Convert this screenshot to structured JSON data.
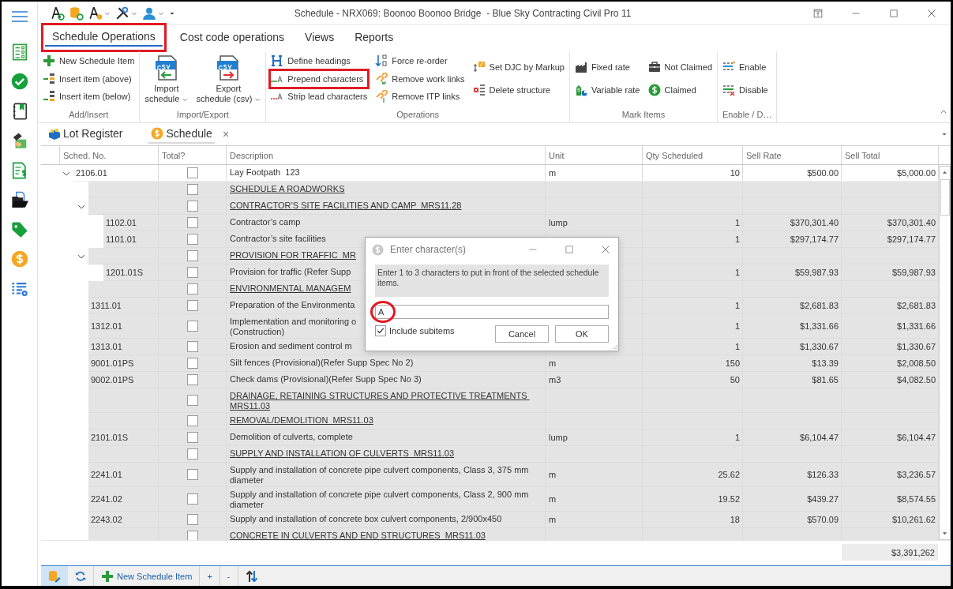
{
  "title_bar": {
    "title": "Schedule - NRX069: Boonoo Boonoo Bridge  - Blue Sky Contracting Civil Pro 11"
  },
  "ribbon": {
    "tabs": [
      {
        "label": "Schedule Operations",
        "selected": true,
        "highlighted": true
      },
      {
        "label": "Cost code operations",
        "selected": false,
        "highlighted": false
      },
      {
        "label": "Views",
        "selected": false,
        "highlighted": false
      },
      {
        "label": "Reports",
        "selected": false,
        "highlighted": false
      }
    ],
    "groups": [
      {
        "kind": "columns",
        "label": "Add/Insert",
        "columns": [
          [
            {
              "label": "New Schedule Item",
              "highlighted": false
            },
            {
              "label": "Insert item (above)",
              "highlighted": false
            },
            {
              "label": "Insert item (below)",
              "highlighted": false
            }
          ]
        ]
      },
      {
        "kind": "large",
        "label": "Import/Export",
        "buttons": [
          {
            "label": "Import\nschedule",
            "dropdown": true
          },
          {
            "label": "Export\nschedule (csv)",
            "dropdown": true
          }
        ]
      },
      {
        "kind": "columns",
        "label": "Operations",
        "columns": [
          [
            {
              "label": "Define headings",
              "highlighted": false
            },
            {
              "label": "Prepend characters",
              "highlighted": true
            },
            {
              "label": "Strip lead characters",
              "highlighted": false
            }
          ],
          [
            {
              "label": "Force re-order",
              "highlighted": false
            },
            {
              "label": "Remove work links",
              "highlighted": false
            },
            {
              "label": "Remove ITP links",
              "highlighted": false
            }
          ],
          [
            {
              "label": "Set DJC by Markup",
              "highlighted": false
            },
            {
              "label": "Delete structure",
              "highlighted": false
            }
          ]
        ]
      },
      {
        "kind": "columns",
        "label": "Mark Items",
        "columns": [
          [
            {
              "label": "Fixed rate",
              "highlighted": false
            },
            {
              "label": "Variable rate",
              "highlighted": false
            }
          ],
          [
            {
              "label": "Not Claimed",
              "highlighted": false
            },
            {
              "label": "Claimed",
              "highlighted": false
            }
          ]
        ]
      },
      {
        "kind": "columns",
        "label": "Enable / D…",
        "columns": [
          [
            {
              "label": "Enable",
              "highlighted": false
            },
            {
              "label": "Disable",
              "highlighted": false
            }
          ]
        ]
      }
    ]
  },
  "document_tabs": [
    {
      "label": "Lot Register",
      "selected": false
    },
    {
      "label": "Schedule",
      "selected": true,
      "close": "×"
    }
  ],
  "grid": {
    "columns": [
      "Sched. No.",
      "Total?",
      "Description",
      "Unit",
      "Qty Scheduled",
      "Sell Rate",
      "Sell Total"
    ],
    "rows": [
      {
        "sched_no": "2106.01",
        "total": false,
        "kind": "item",
        "description": "Lay Footpath  123",
        "unit": "m",
        "qty": "10",
        "sell_rate": "$500.00",
        "sell_total": "$5,000.00",
        "selected": false,
        "expanded": true,
        "children": [
          {
            "total": false,
            "kind": "heading",
            "description": "SCHEDULE A ROADWORKS",
            "selected": true
          },
          {
            "total": false,
            "kind": "heading",
            "description": "CONTRACTOR’S SITE FACILITIES AND CAMP  MRS11.28",
            "selected": true,
            "expanded": true,
            "children": [
              {
                "sched_no": "1102.01",
                "total": false,
                "kind": "item",
                "description": "Contractor’s camp",
                "unit": "lump",
                "qty": "1",
                "sell_rate": "$370,301.40",
                "sell_total": "$370,301.40",
                "selected": true
              },
              {
                "sched_no": "1101.01",
                "total": false,
                "kind": "item",
                "description": "Contractor’s site facilities",
                "qty": "1",
                "sell_rate": "$297,174.77",
                "sell_total": "$297,174.77",
                "selected": true
              }
            ]
          },
          {
            "total": false,
            "kind": "heading",
            "description": "PROVISION FOR TRAFFIC  MR",
            "selected": true,
            "expanded": true,
            "children": [
              {
                "sched_no": "1201.01S",
                "total": false,
                "kind": "item",
                "description": "Provision for traffic (Refer Supp",
                "qty": "1",
                "sell_rate": "$59,987.93",
                "sell_total": "$59,987.93",
                "selected": true
              }
            ]
          },
          {
            "total": false,
            "kind": "heading",
            "description": "ENVIRONMENTAL MANAGEM",
            "selected": true
          },
          {
            "sched_no": "1311.01",
            "total": false,
            "kind": "item",
            "description": "Preparation of the Environmenta",
            "qty": "1",
            "sell_rate": "$2,681.83",
            "sell_total": "$2,681.83",
            "selected": true
          },
          {
            "sched_no": "1312.01",
            "total": false,
            "kind": "item",
            "description": "Implementation and monitoring o\n(Construction)",
            "qty": "1",
            "sell_rate": "$1,331.66",
            "sell_total": "$1,331.66",
            "selected": true
          },
          {
            "sched_no": "1313.01",
            "total": false,
            "kind": "item",
            "description": "Erosion and sediment control m",
            "qty": "1",
            "sell_rate": "$1,330.67",
            "sell_total": "$1,330.67",
            "selected": true
          },
          {
            "sched_no": "9001.01PS",
            "total": false,
            "kind": "item",
            "description": "Silt fences (Provisional)(Refer Supp Spec No 2)",
            "unit": "m",
            "qty": "150",
            "sell_rate": "$13.39",
            "sell_total": "$2,008.50",
            "selected": true
          },
          {
            "sched_no": "9002.01PS",
            "total": false,
            "kind": "item",
            "description": "Check dams (Provisional)(Refer Supp Spec No 3)",
            "unit": "m3",
            "qty": "50",
            "sell_rate": "$81.65",
            "sell_total": "$4,082.50",
            "selected": true
          },
          {
            "total": false,
            "kind": "heading",
            "description": "DRAINAGE, RETAINING STRUCTURES AND PROTECTIVE TREATMENTS MRS11.03",
            "selected": true
          },
          {
            "total": false,
            "kind": "heading",
            "description": "REMOVAL/DEMOLITION  MRS11.03",
            "selected": true
          },
          {
            "sched_no": "2101.01S",
            "total": false,
            "kind": "item",
            "description": "Demolition of culverts, complete",
            "unit": "lump",
            "qty": "1",
            "sell_rate": "$6,104.47",
            "sell_total": "$6,104.47",
            "selected": true
          },
          {
            "total": false,
            "kind": "heading",
            "description": "SUPPLY AND INSTALLATION OF CULVERTS  MRS11.03",
            "selected": true
          },
          {
            "sched_no": "2241.01",
            "total": false,
            "kind": "item",
            "description": "Supply and installation of concrete pipe culvert components, Class 3, 375 mm diameter",
            "unit": "m",
            "qty": "25.62",
            "sell_rate": "$126.33",
            "sell_total": "$3,236.57",
            "selected": true
          },
          {
            "sched_no": "2241.02",
            "total": false,
            "kind": "item",
            "description": "Supply and installation of concrete pipe culvert components, Class 2, 900 mm diameter",
            "unit": "m",
            "qty": "19.52",
            "sell_rate": "$439.27",
            "sell_total": "$8,574.55",
            "selected": true
          },
          {
            "sched_no": "2243.02",
            "total": false,
            "kind": "item",
            "description": "Supply and installation of concrete box culvert components, 2/900x450",
            "unit": "m",
            "qty": "18",
            "sell_rate": "$570.09",
            "sell_total": "$10,261.62",
            "selected": true
          },
          {
            "total": false,
            "kind": "heading",
            "description": "CONCRETE IN CULVERTS AND END STRUCTURES  MRS11.03",
            "selected": true
          }
        ]
      }
    ],
    "summary_total": "$3,391,262"
  },
  "bottom_toolbar": {
    "edit_selected": true,
    "new_item": "New Schedule Item",
    "expand": "+",
    "collapse": "-"
  },
  "dialog": {
    "title": "Enter character(s)",
    "message": "Enter 1 to 3 characters to put in front of the selected schedule items.",
    "field": {
      "value": "A",
      "highlighted": true
    },
    "include_subitems": {
      "label": "Include subitems",
      "checked": true
    },
    "buttons": [
      "Cancel",
      "OK"
    ]
  }
}
